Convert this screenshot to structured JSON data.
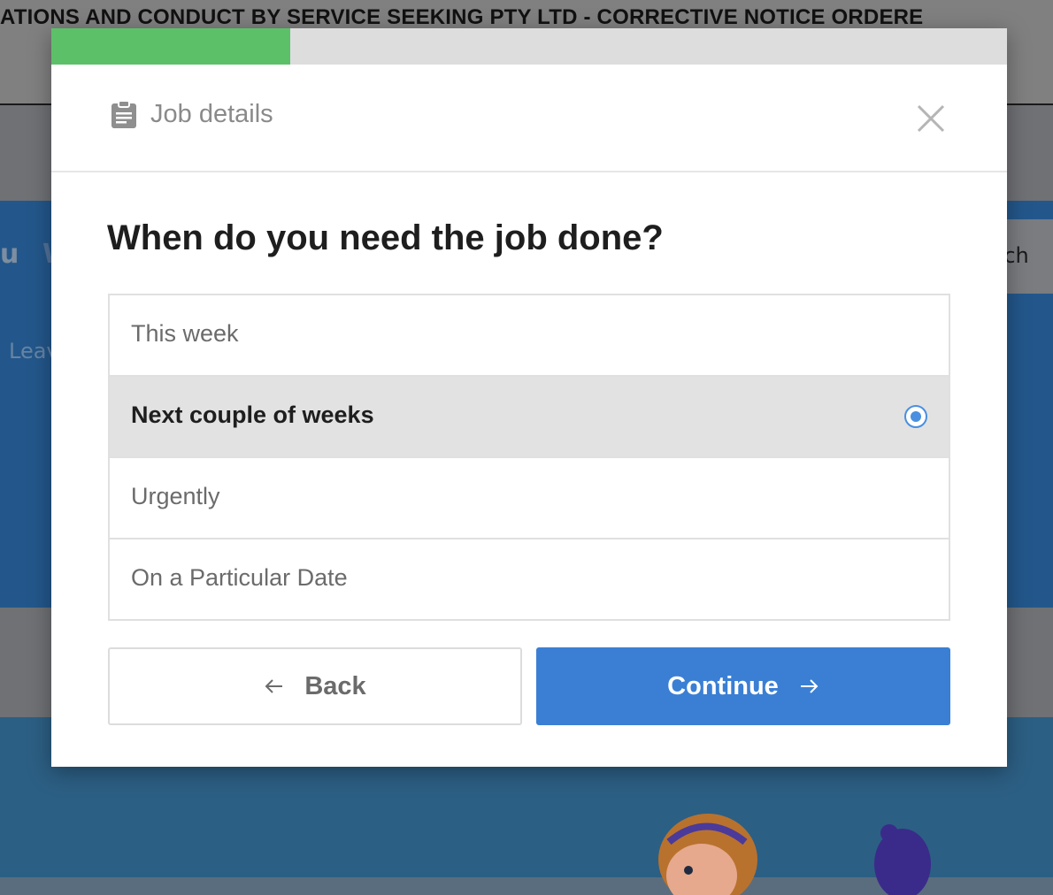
{
  "background": {
    "banner_text": "ATIONS AND CONDUCT BY SERVICE SEEKING PTY LTD - CORRECTIVE NOTICE ORDERE",
    "menu_fragment_a": "u",
    "menu_fragment_b": "W",
    "leave_fragment": "Leav",
    "search_fragment": "rch"
  },
  "modal": {
    "progress_fraction": 0.25,
    "progress_color": "#5cc068",
    "header_icon": "clipboard-icon",
    "header_title": "Job details",
    "close_icon": "close-icon",
    "question": "When do you need the job done?",
    "options": [
      {
        "label": "This week",
        "selected": false
      },
      {
        "label": "Next couple of weeks",
        "selected": true
      },
      {
        "label": "Urgently",
        "selected": false
      },
      {
        "label": "On a Particular Date",
        "selected": false
      }
    ],
    "back_label": "Back",
    "back_icon": "arrow-left-icon",
    "continue_label": "Continue",
    "continue_icon": "arrow-right-icon",
    "accent_color": "#3a7fd4"
  }
}
